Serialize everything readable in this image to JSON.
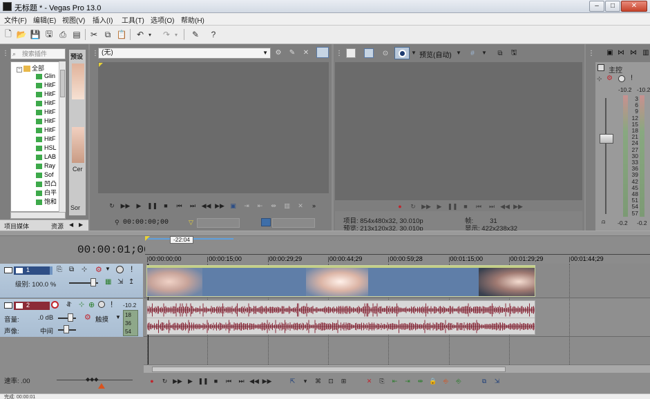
{
  "window": {
    "title": "无标题 * - Vegas Pro 13.0"
  },
  "menu": [
    "文件(F)",
    "编辑(E)",
    "视图(V)",
    "插入(I)",
    "工具(T)",
    "选项(O)",
    "帮助(H)"
  ],
  "plugins": {
    "search_placeholder": "搜索插件",
    "root": "全部",
    "items": [
      "Glin",
      "HitF",
      "HitF",
      "HitF",
      "HitF",
      "HitF",
      "HitF",
      "HitF",
      "HSL",
      "LAB",
      "Ray",
      "Sof",
      "凹凸",
      "白平",
      "饱和"
    ],
    "presets_label": "预设",
    "thumb_labels": [
      "Cer",
      "Sor"
    ],
    "tabs": [
      "项目媒体",
      "资源"
    ]
  },
  "trimmer": {
    "dropdown": "(无)",
    "timecode": "00:00:00;00"
  },
  "preview": {
    "mode": "预览(自动)",
    "project_label": "项目:",
    "project_value": "854x480x32, 30.010p",
    "preview_label": "预览:",
    "preview_value": "213x120x32, 30.010p",
    "frame_label": "帧:",
    "frame_value": "31",
    "display_label": "显示:",
    "display_value": "422x238x32"
  },
  "master": {
    "title": "主控",
    "left_peak": "-10.2",
    "right_peak": "-10.2",
    "scale": [
      "3",
      "6",
      "9",
      "12",
      "15",
      "18",
      "21",
      "24",
      "27",
      "30",
      "33",
      "36",
      "39",
      "42",
      "45",
      "48",
      "51",
      "54",
      "57"
    ],
    "bottom_left": "-0.2",
    "bottom_right": "-0.2"
  },
  "timeline": {
    "cursor": "00:00:01;00",
    "region_marker": "-22:04",
    "ruler": [
      "00:00:00;00",
      "00:00:15;00",
      "00:00:29;29",
      "00:00:44;29",
      "00:00:59;28",
      "00:01:15;00",
      "00:01:29;29",
      "00:01:44;29"
    ],
    "video_track": {
      "number": "1",
      "level_label": "级别:",
      "level_value": "100.0 %"
    },
    "audio_track": {
      "number": "2",
      "peak": "-10.2",
      "volume_label": "音量:",
      "volume_value": ".0 dB",
      "pan_label": "声像:",
      "pan_value": "中间",
      "fx_label": "触摸",
      "meter_scale": [
        "18",
        "36",
        "54"
      ]
    },
    "rate_label": "速率:",
    "rate_value": ".00"
  },
  "status": {
    "left": "完成: 00:00:01"
  },
  "colors": {
    "accent": "#6b8ab0",
    "wave": "#8a2a3a",
    "wave_bg": "#d8d8d8",
    "video_clip": "#5f7ea8"
  }
}
